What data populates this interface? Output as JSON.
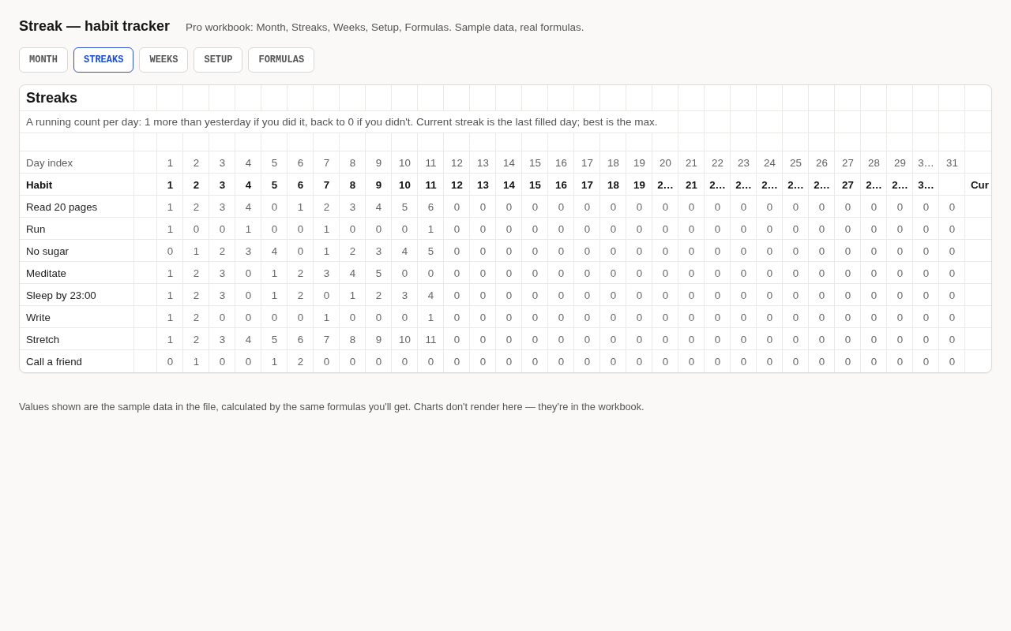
{
  "header": {
    "title": "Streak — habit tracker",
    "subtitle": "Pro workbook: Month, Streaks, Weeks, Setup, Formulas. Sample data, real formulas."
  },
  "tabs": [
    {
      "label": "MONTH",
      "selected": false
    },
    {
      "label": "STREAKS",
      "selected": true
    },
    {
      "label": "WEEKS",
      "selected": false
    },
    {
      "label": "SETUP",
      "selected": false
    },
    {
      "label": "FORMULAS",
      "selected": false
    }
  ],
  "sheet": {
    "title": "Streaks",
    "description": "A running count per day: 1 more than yesterday if you did it, back to 0 if you didn't. Current streak is the last filled day; best is the max.",
    "day_index_row": {
      "label": "Day index",
      "values": [
        "1",
        "2",
        "3",
        "4",
        "5",
        "6",
        "7",
        "8",
        "9",
        "10",
        "11",
        "12",
        "13",
        "14",
        "15",
        "16",
        "17",
        "18",
        "19",
        "20",
        "21",
        "22",
        "23",
        "24",
        "25",
        "26",
        "27",
        "28",
        "29",
        "3…",
        "31"
      ]
    },
    "habit_row": {
      "label": "Habit",
      "values": [
        "1",
        "2",
        "3",
        "4",
        "5",
        "6",
        "7",
        "8",
        "9",
        "10",
        "11",
        "12",
        "13",
        "14",
        "15",
        "16",
        "17",
        "18",
        "19",
        "2…",
        "21",
        "2…",
        "2…",
        "2…",
        "2…",
        "2…",
        "27",
        "2…",
        "2…",
        "3…"
      ],
      "trailing": "Cur"
    },
    "rows": [
      {
        "name": "Read 20 pages",
        "values": [
          "1",
          "2",
          "3",
          "4",
          "0",
          "1",
          "2",
          "3",
          "4",
          "5",
          "6",
          "0",
          "0",
          "0",
          "0",
          "0",
          "0",
          "0",
          "0",
          "0",
          "0",
          "0",
          "0",
          "0",
          "0",
          "0",
          "0",
          "0",
          "0",
          "0",
          "0"
        ]
      },
      {
        "name": "Run",
        "values": [
          "1",
          "0",
          "0",
          "1",
          "0",
          "0",
          "1",
          "0",
          "0",
          "0",
          "1",
          "0",
          "0",
          "0",
          "0",
          "0",
          "0",
          "0",
          "0",
          "0",
          "0",
          "0",
          "0",
          "0",
          "0",
          "0",
          "0",
          "0",
          "0",
          "0",
          "0"
        ]
      },
      {
        "name": "No sugar",
        "values": [
          "0",
          "1",
          "2",
          "3",
          "4",
          "0",
          "1",
          "2",
          "3",
          "4",
          "5",
          "0",
          "0",
          "0",
          "0",
          "0",
          "0",
          "0",
          "0",
          "0",
          "0",
          "0",
          "0",
          "0",
          "0",
          "0",
          "0",
          "0",
          "0",
          "0",
          "0"
        ]
      },
      {
        "name": "Meditate",
        "values": [
          "1",
          "2",
          "3",
          "0",
          "1",
          "2",
          "3",
          "4",
          "5",
          "0",
          "0",
          "0",
          "0",
          "0",
          "0",
          "0",
          "0",
          "0",
          "0",
          "0",
          "0",
          "0",
          "0",
          "0",
          "0",
          "0",
          "0",
          "0",
          "0",
          "0",
          "0"
        ]
      },
      {
        "name": "Sleep by 23:00",
        "values": [
          "1",
          "2",
          "3",
          "0",
          "1",
          "2",
          "0",
          "1",
          "2",
          "3",
          "4",
          "0",
          "0",
          "0",
          "0",
          "0",
          "0",
          "0",
          "0",
          "0",
          "0",
          "0",
          "0",
          "0",
          "0",
          "0",
          "0",
          "0",
          "0",
          "0",
          "0"
        ]
      },
      {
        "name": "Write",
        "values": [
          "1",
          "2",
          "0",
          "0",
          "0",
          "0",
          "1",
          "0",
          "0",
          "0",
          "1",
          "0",
          "0",
          "0",
          "0",
          "0",
          "0",
          "0",
          "0",
          "0",
          "0",
          "0",
          "0",
          "0",
          "0",
          "0",
          "0",
          "0",
          "0",
          "0",
          "0"
        ]
      },
      {
        "name": "Stretch",
        "values": [
          "1",
          "2",
          "3",
          "4",
          "5",
          "6",
          "7",
          "8",
          "9",
          "10",
          "11",
          "0",
          "0",
          "0",
          "0",
          "0",
          "0",
          "0",
          "0",
          "0",
          "0",
          "0",
          "0",
          "0",
          "0",
          "0",
          "0",
          "0",
          "0",
          "0",
          "0"
        ]
      },
      {
        "name": "Call a friend",
        "values": [
          "0",
          "1",
          "0",
          "0",
          "1",
          "2",
          "0",
          "0",
          "0",
          "0",
          "0",
          "0",
          "0",
          "0",
          "0",
          "0",
          "0",
          "0",
          "0",
          "0",
          "0",
          "0",
          "0",
          "0",
          "0",
          "0",
          "0",
          "0",
          "0",
          "0",
          "0"
        ]
      }
    ]
  },
  "footer": "Values shown are the sample data in the file, calculated by the same formulas you'll get. Charts don't render here — they're in the workbook."
}
